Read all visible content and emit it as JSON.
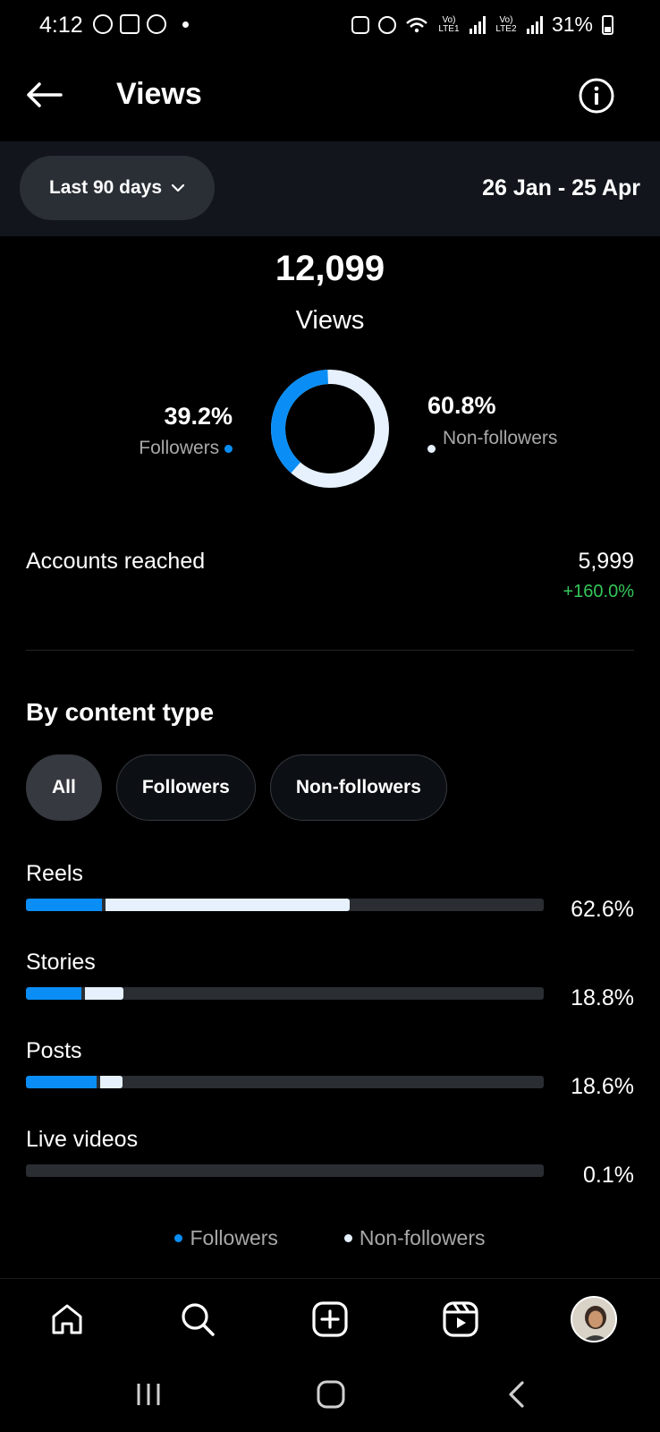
{
  "status_bar": {
    "time": "4:12",
    "lte1": "Vo) LTE1",
    "lte2": "Vo) LTE2",
    "battery": "31%"
  },
  "header": {
    "title": "Views"
  },
  "date_filter": {
    "range_label": "Last 90 days",
    "dates": "26 Jan - 25 Apr"
  },
  "summary": {
    "total": "12,099",
    "total_label": "Views",
    "followers_pct": "39.2%",
    "followers_label": "Followers",
    "followers_fraction": 0.392,
    "non_followers_pct": "60.8%",
    "non_followers_label": "Non-followers",
    "colors": {
      "followers": "#0a8ef5",
      "non_followers": "#e6f1fd"
    }
  },
  "accounts_reached": {
    "label": "Accounts reached",
    "value": "5,999",
    "change": "+160.0%"
  },
  "content_type": {
    "title": "By content type",
    "tabs": [
      {
        "label": "All",
        "active": true
      },
      {
        "label": "Followers",
        "active": false
      },
      {
        "label": "Non-followers",
        "active": false
      }
    ],
    "rows": [
      {
        "label": "Reels",
        "pct": "62.6%",
        "total": 0.626,
        "followers": 0.15,
        "non_followers": 0.476
      },
      {
        "label": "Stories",
        "pct": "18.8%",
        "total": 0.188,
        "followers": 0.11,
        "non_followers": 0.078
      },
      {
        "label": "Posts",
        "pct": "18.6%",
        "total": 0.186,
        "followers": 0.14,
        "non_followers": 0.046
      },
      {
        "label": "Live videos",
        "pct": "0.1%",
        "total": 0.001,
        "followers": 0.0,
        "non_followers": 0.001
      }
    ],
    "legend": {
      "followers": "Followers",
      "non_followers": "Non-followers"
    }
  },
  "bottom_nav": [
    "home-icon",
    "search-icon",
    "create-icon",
    "reels-icon",
    "profile-avatar"
  ],
  "system_nav": [
    "recents-icon",
    "home-icon",
    "back-icon"
  ]
}
